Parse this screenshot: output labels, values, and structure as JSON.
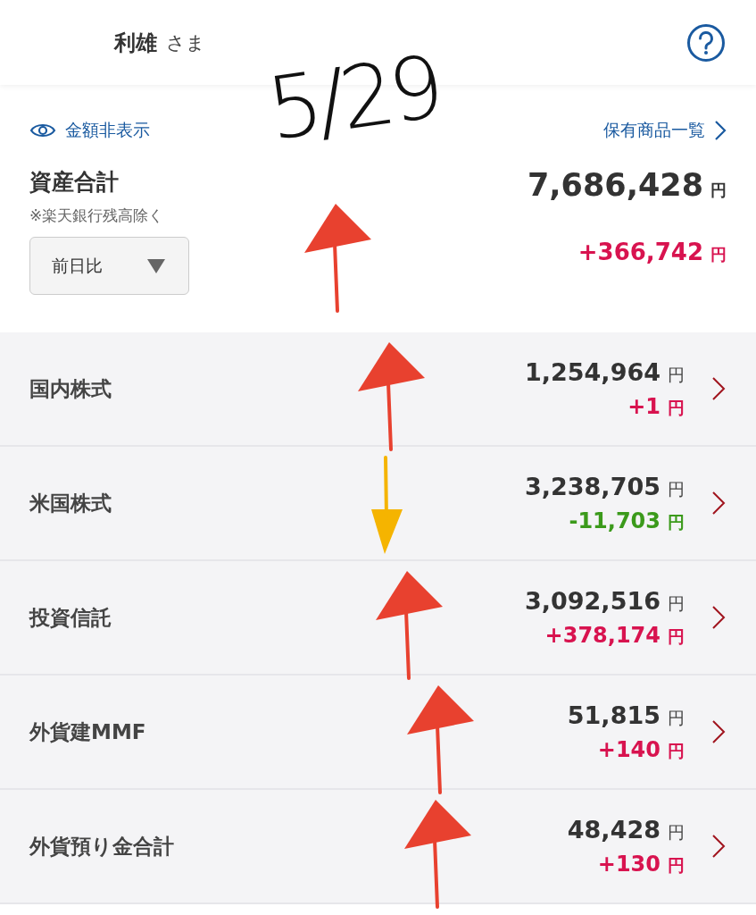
{
  "header": {
    "name": "利雄",
    "honorific": "さま"
  },
  "annotation": {
    "text": "5/29"
  },
  "summary": {
    "hide_link": "金額非表示",
    "holdings_link": "保有商品一覧",
    "title": "資産合計",
    "note": "※楽天銀行残高除く",
    "period": "前日比",
    "total": "7,686,428",
    "total_unit": "円",
    "change": {
      "value": "+366,742",
      "unit": "円",
      "kind": "up"
    }
  },
  "rows": [
    {
      "label": "国内株式",
      "amount": "1,254,964",
      "amount_unit": "円",
      "change": {
        "value": "+1",
        "unit": "円",
        "kind": "up"
      }
    },
    {
      "label": "米国株式",
      "amount": "3,238,705",
      "amount_unit": "円",
      "change": {
        "value": "-11,703",
        "unit": "円",
        "kind": "down"
      }
    },
    {
      "label": "投資信託",
      "amount": "3,092,516",
      "amount_unit": "円",
      "change": {
        "value": "+378,174",
        "unit": "円",
        "kind": "up"
      }
    },
    {
      "label": "外貨建MMF",
      "amount": "51,815",
      "amount_unit": "円",
      "change": {
        "value": "+140",
        "unit": "円",
        "kind": "up"
      }
    },
    {
      "label": "外貨預り金合計",
      "amount": "48,428",
      "amount_unit": "円",
      "change": {
        "value": "+130",
        "unit": "円",
        "kind": "up"
      }
    }
  ]
}
